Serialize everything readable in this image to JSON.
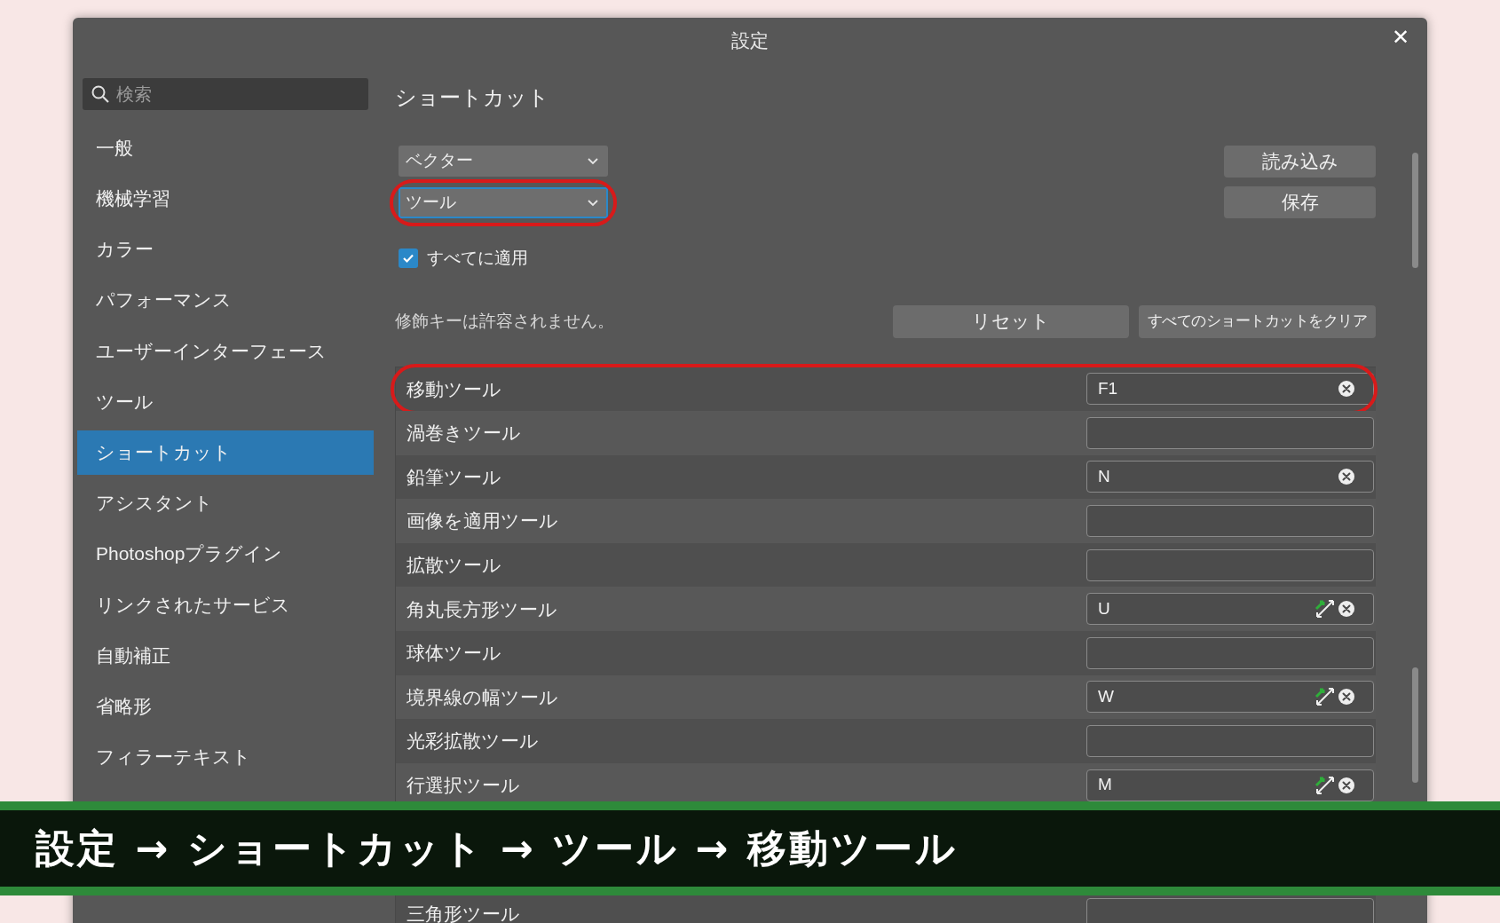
{
  "window": {
    "title": "設定",
    "close": "✕"
  },
  "search": {
    "placeholder": "検索"
  },
  "sidebar": {
    "items": [
      {
        "label": "一般",
        "selected": false
      },
      {
        "label": "機械学習",
        "selected": false
      },
      {
        "label": "カラー",
        "selected": false
      },
      {
        "label": "パフォーマンス",
        "selected": false
      },
      {
        "label": "ユーザーインターフェース",
        "selected": false
      },
      {
        "label": "ツール",
        "selected": false
      },
      {
        "label": "ショートカット",
        "selected": true
      },
      {
        "label": "アシスタント",
        "selected": false
      },
      {
        "label": "Photoshopプラグイン",
        "selected": false
      },
      {
        "label": "リンクされたサービス",
        "selected": false
      },
      {
        "label": "自動補正",
        "selected": false
      },
      {
        "label": "省略形",
        "selected": false
      },
      {
        "label": "フィラーテキスト",
        "selected": false
      }
    ]
  },
  "content": {
    "heading": "ショートカット",
    "dropdowns": [
      {
        "value": "ベクター",
        "focused": false,
        "highlighted": false
      },
      {
        "value": "ツール",
        "focused": true,
        "highlighted": true
      }
    ],
    "buttons": [
      "読み込み",
      "保存"
    ],
    "apply_all": {
      "label": "すべてに適用",
      "checked": true
    },
    "note": "修飾キーは許容されません。",
    "actions": [
      "リセット",
      "すべてのショートカットをクリア"
    ],
    "rows": [
      {
        "name": "移動ツール",
        "kind": "key",
        "value": "F1",
        "highlighted": true
      },
      {
        "name": "渦巻きツール",
        "kind": "empty",
        "highlighted": false
      },
      {
        "name": "鉛筆ツール",
        "kind": "key",
        "value": "N",
        "highlighted": false
      },
      {
        "name": "画像を適用ツール",
        "kind": "empty",
        "highlighted": false
      },
      {
        "name": "拡散ツール",
        "kind": "empty",
        "highlighted": false
      },
      {
        "name": "角丸長方形ツール",
        "kind": "adjustable",
        "value": "U",
        "highlighted": false
      },
      {
        "name": "球体ツール",
        "kind": "empty",
        "highlighted": false
      },
      {
        "name": "境界線の幅ツール",
        "kind": "adjustable",
        "value": "W",
        "highlighted": false
      },
      {
        "name": "光彩拡散ツール",
        "kind": "empty",
        "highlighted": false
      },
      {
        "name": "行選択ツール",
        "kind": "adjustable",
        "value": "M",
        "highlighted": false
      },
      {
        "name": "三角形ツール",
        "kind": "empty",
        "highlighted": false
      }
    ]
  },
  "caption": {
    "text": "設定 → ショートカット → ツール → 移動ツール"
  }
}
